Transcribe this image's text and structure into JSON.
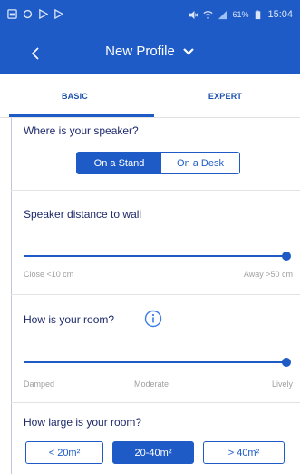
{
  "status": {
    "battery": "61%",
    "time": "15:04"
  },
  "header": {
    "title": "New Profile"
  },
  "tabs": [
    {
      "label": "BASIC",
      "selected": true
    },
    {
      "label": "EXPERT",
      "selected": false
    }
  ],
  "location": {
    "question": "Where is your speaker?",
    "options": [
      "On a Stand",
      "On a Desk"
    ],
    "selected": "On a Stand"
  },
  "distance": {
    "label": "Speaker distance to wall",
    "min_label": "Close <10 cm",
    "max_label": "Away >50 cm",
    "value": 1.0
  },
  "room": {
    "question": "How is your room?",
    "labels": [
      "Damped",
      "Moderate",
      "Lively"
    ],
    "value": 1.0
  },
  "size": {
    "question": "How large is your room?",
    "options": [
      "< 20m²",
      "20-40m²",
      "> 40m²"
    ],
    "selected": "20-40m²"
  },
  "colors": {
    "accent": "#1e5bc6",
    "text": "#1e2a6b",
    "muted": "#a0a0a0"
  }
}
